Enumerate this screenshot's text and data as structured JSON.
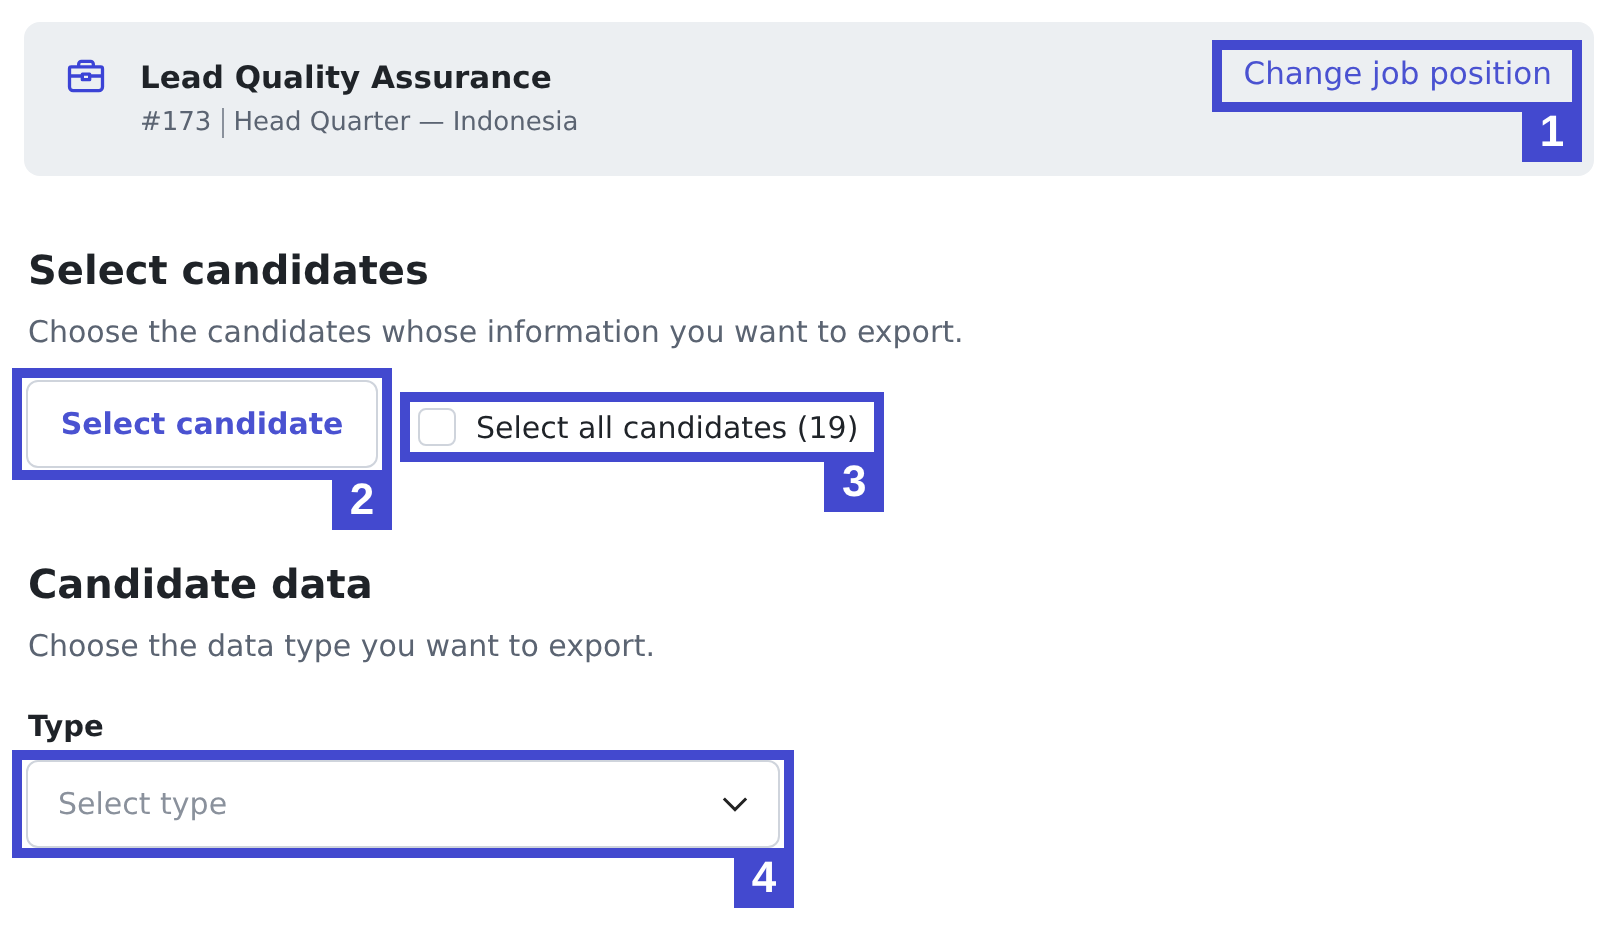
{
  "job": {
    "title": "Lead Quality Assurance",
    "id": "#173",
    "location": "Head Quarter — Indonesia",
    "change_link": {
      "label": "Change job position",
      "callout": "1"
    }
  },
  "select_candidates": {
    "heading": "Select candidates",
    "description": "Choose the candidates whose information you want to export.",
    "button": {
      "label": "Select candidate",
      "callout": "2"
    },
    "select_all": {
      "label": "Select all candidates (19)",
      "checked": false,
      "callout": "3"
    }
  },
  "candidate_data": {
    "heading": "Candidate data",
    "description": "Choose the data type you want to export.",
    "type_field": {
      "label": "Type",
      "placeholder": "Select type",
      "callout": "4"
    }
  }
}
